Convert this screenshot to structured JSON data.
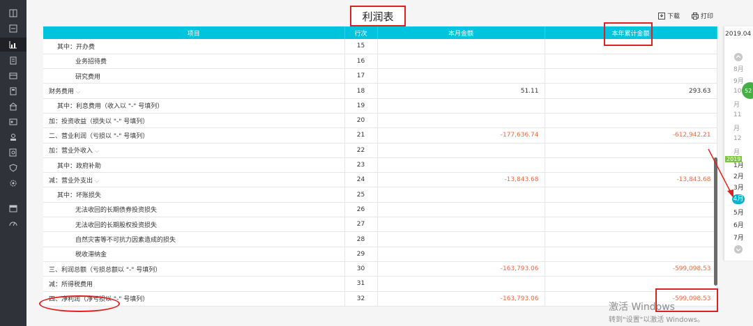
{
  "title": "利润表",
  "toolbar": {
    "download_label": "下载",
    "print_label": "打印"
  },
  "table": {
    "columns": [
      "项目",
      "行次",
      "本月金额",
      "本年累计金额"
    ],
    "rows": [
      {
        "item": "其中：开办费",
        "row": "15",
        "month": "",
        "ytd": ""
      },
      {
        "item": "业务招待费",
        "row": "16",
        "month": "",
        "ytd": ""
      },
      {
        "item": "研究费用",
        "row": "17",
        "month": "",
        "ytd": ""
      },
      {
        "item": "财务费用",
        "row": "18",
        "month": "51.11",
        "ytd": "293.63"
      },
      {
        "item": "其中：利息费用（收入以 \"-\" 号填列）",
        "row": "19",
        "month": "",
        "ytd": ""
      },
      {
        "item": "加：投资收益（损失以 \"-\" 号填列）",
        "row": "20",
        "month": "",
        "ytd": ""
      },
      {
        "item": "二、营业利润（亏损以 \"-\" 号填列）",
        "row": "21",
        "month": "-177,636.74",
        "ytd": "-612,942.21"
      },
      {
        "item": "加：营业外收入",
        "row": "22",
        "month": "",
        "ytd": ""
      },
      {
        "item": "其中：政府补助",
        "row": "23",
        "month": "",
        "ytd": ""
      },
      {
        "item": "减：营业外支出",
        "row": "24",
        "month": "-13,843.68",
        "ytd": "-13,843.68"
      },
      {
        "item": "其中：坏账损失",
        "row": "25",
        "month": "",
        "ytd": ""
      },
      {
        "item": "无法收回的长期债券投资损失",
        "row": "26",
        "month": "",
        "ytd": ""
      },
      {
        "item": "无法收回的长期股权投资损失",
        "row": "27",
        "month": "",
        "ytd": ""
      },
      {
        "item": "自然灾害等不可抗力因素造成的损失",
        "row": "28",
        "month": "",
        "ytd": ""
      },
      {
        "item": "税收滞纳金",
        "row": "29",
        "month": "",
        "ytd": ""
      },
      {
        "item": "三、利润总额（亏损总额以 \"-\" 号填列）",
        "row": "30",
        "month": "-163,793.06",
        "ytd": "-599,098.53"
      },
      {
        "item": "减：所得税费用",
        "row": "31",
        "month": "",
        "ytd": ""
      },
      {
        "item": "四、净利润（净亏损以 \"-\" 号填列）",
        "row": "32",
        "month": "-163,793.06",
        "ytd": "-599,098.53"
      }
    ]
  },
  "period": {
    "current": "2019.04",
    "year_tag": "2019",
    "months": [
      "8月",
      "9月",
      "10",
      "月",
      "11",
      "月",
      "12",
      "月",
      "1月",
      "2月",
      "3月",
      "4月",
      "5月",
      "6月",
      "7月"
    ],
    "selected": "4月"
  },
  "badge": "52",
  "watermark": {
    "line1": "激活 Windows",
    "line2": "转到\"设置\"以激活 Windows。"
  },
  "colors": {
    "header": "#00c3de",
    "negative": "#f5683e",
    "highlight": "#e02020",
    "sidebar": "#2f3238"
  }
}
